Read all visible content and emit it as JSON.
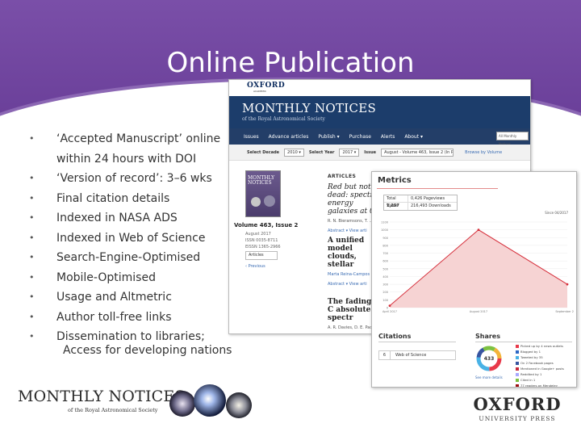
{
  "slide": {
    "title": "Online Publication",
    "bullets": [
      "‘Accepted Manuscript’ online within 24 hours with DOI",
      "‘Version of record’: 3–6 wks",
      "Final citation details",
      "Indexed in NASA ADS",
      "Indexed in Web of Science",
      "Search-Engine-Optimised",
      "Mobile-Optimised",
      "Usage and Altmetric",
      "Author toll-free links",
      "Dissemination to libraries;"
    ],
    "bullet_extra": "Access for developing nations",
    "bullet_glyph": "•"
  },
  "journal_site": {
    "publisher": "OXFORD",
    "publisher_sub": "ACADEMIC",
    "banner_title": "MONTHLY NOTICES",
    "banner_subtitle": "of the Royal Astronomical Society",
    "nav": [
      "Issues",
      "Advance articles",
      "Publish ▾",
      "Purchase",
      "Alerts",
      "About ▾"
    ],
    "search_placeholder": "All Monthly Notices",
    "select_decade_label": "Select Decade",
    "select_decade_value": "2010 ▾",
    "select_year_label": "Select Year",
    "select_year_value": "2017 ▾",
    "issue_label": "Issue",
    "issue_value": "August - Volume 463, Issue 2 (In Progress), Pages 1205 - 19..▾",
    "browse_link": "Browse by Volume",
    "cover_title": "MONTHLY NOTICES",
    "volume": "Volume 463, Issue 2",
    "date": "August 2017",
    "issn1": "ISSN 0035-8711",
    "issn2": "EISSN 1365-2966",
    "contents_button": "Articles",
    "prev_link": "‹ Previous",
    "articles_heading": "ARTICLES",
    "articles": [
      {
        "title": "Red but not dead: spectral energy galaxies at 0 <",
        "authors": "R. N. Bieramsons, T. ...",
        "links": "Abstract ▾   View arti"
      },
      {
        "title": "A unified model clouds, stellar",
        "authors": "Marta Reina-Campos",
        "links": "Abstract ▾   View arti"
      },
      {
        "title": "The fading of C absolute spectr",
        "authors": "A. R. Davies, D. E. Pac...",
        "links": ""
      }
    ]
  },
  "metrics_panel": {
    "title": "Metrics",
    "total_views_label": "Total Views",
    "total_views_value": "1,257",
    "row1": "0,426 Pageviews",
    "row2": "216,493 Downloads",
    "since": "Since 04/2017",
    "accent_color": "#d6303c",
    "citations_title": "Citations",
    "citations_count": "6",
    "citations_source": "Web of Science",
    "shares_title": "Shares",
    "shares_total": "433",
    "shares_link": "See more details",
    "share_legend": [
      {
        "label": "Picked up by 4 news outlets",
        "color": "#e8394a"
      },
      {
        "label": "Blogged by 1",
        "color": "#2d67c4"
      },
      {
        "label": "Tweeted by 35",
        "color": "#49b2e6"
      },
      {
        "label": "On 2 Facebook pages",
        "color": "#3754a0"
      },
      {
        "label": "Mentioned in Google+ posts",
        "color": "#c7283b"
      },
      {
        "label": "Reddited by 1",
        "color": "#a8a8ff"
      },
      {
        "label": "Cited in 1",
        "color": "#7dc242"
      },
      {
        "label": "77 readers on Mendeley",
        "color": "#9c0f10"
      }
    ]
  },
  "chart_data": {
    "type": "line",
    "title": "",
    "xlabel": "",
    "ylabel": "",
    "x_ticks": [
      "April 2017",
      "August 2017",
      "September 2017"
    ],
    "y_ticks": [
      "1100",
      "1000",
      "900",
      "800",
      "700",
      "600",
      "500",
      "400",
      "300",
      "200",
      "100",
      "0"
    ],
    "ylim": [
      0,
      1100
    ],
    "series": [
      {
        "values": [
          {
            "x": 0,
            "y": 25
          },
          {
            "x": 1,
            "y": 1000
          },
          {
            "x": 2,
            "y": 300
          }
        ]
      }
    ],
    "fill": true,
    "line_color": "#d6303c",
    "fill_color": "#f6d3d3"
  },
  "footer": {
    "journal_logo": "MONTHLY NOTICES",
    "journal_logo_sub": "of the Royal Astronomical Society",
    "publisher_logo": "OXFORD",
    "publisher_logo_sub": "UNIVERSITY PRESS"
  }
}
